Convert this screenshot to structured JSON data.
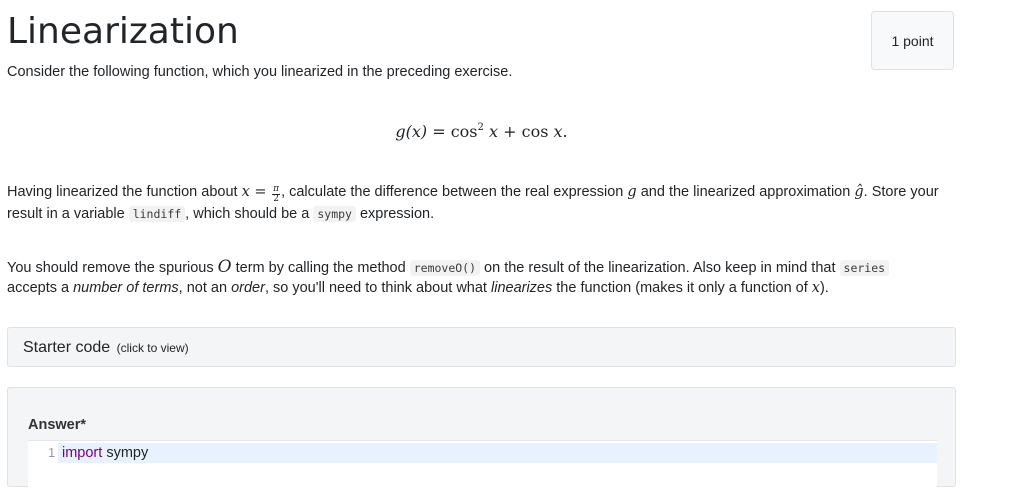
{
  "header": {
    "title": "Linearization",
    "points": "1 point"
  },
  "intro": "Consider the following function, which you linearized in the preceding exercise.",
  "equation": {
    "lhs": "g(x)",
    "equals": "=",
    "rhs_a": "cos",
    "rhs_a_exp": "2",
    "rhs_a_var": "x",
    "plus": "+",
    "rhs_b": "cos",
    "rhs_b_var": "x",
    "period": "."
  },
  "diff_paragraph": {
    "t1": "Having linearized the function about ",
    "var_x": "x",
    "eq": " = ",
    "frac_num": "π",
    "frac_den": "2",
    "t2": ", calculate the difference between the real expression ",
    "var_g": "g",
    "t3": " and the linearized approximation ",
    "var_ghat": "ĝ",
    "t4": ". Store your result in a variable ",
    "code_lindiff": "lindiff",
    "t5": ", which should be a ",
    "code_sympy": "sympy",
    "t6": " expression."
  },
  "remove_paragraph": {
    "t1": "You should remove the spurious ",
    "var_O": "O",
    "t2": " term by calling the method ",
    "code_removeO": "removeO()",
    "t3": " on the result of the linearization. Also keep in mind that ",
    "code_series": "series",
    "t4": " accepts a ",
    "em1": "number of terms",
    "t5": ", not an ",
    "em2": "order",
    "t6": ", so you'll need to think about what ",
    "em3": "linearizes",
    "t7": " the function (makes it only a function of ",
    "var_x": "x",
    "t8": ")."
  },
  "starter": {
    "label": "Starter code",
    "hint": "(click to view)"
  },
  "answer": {
    "label": "Answer*",
    "line_number": "1",
    "code_keyword": "import",
    "code_rest": " sympy"
  }
}
